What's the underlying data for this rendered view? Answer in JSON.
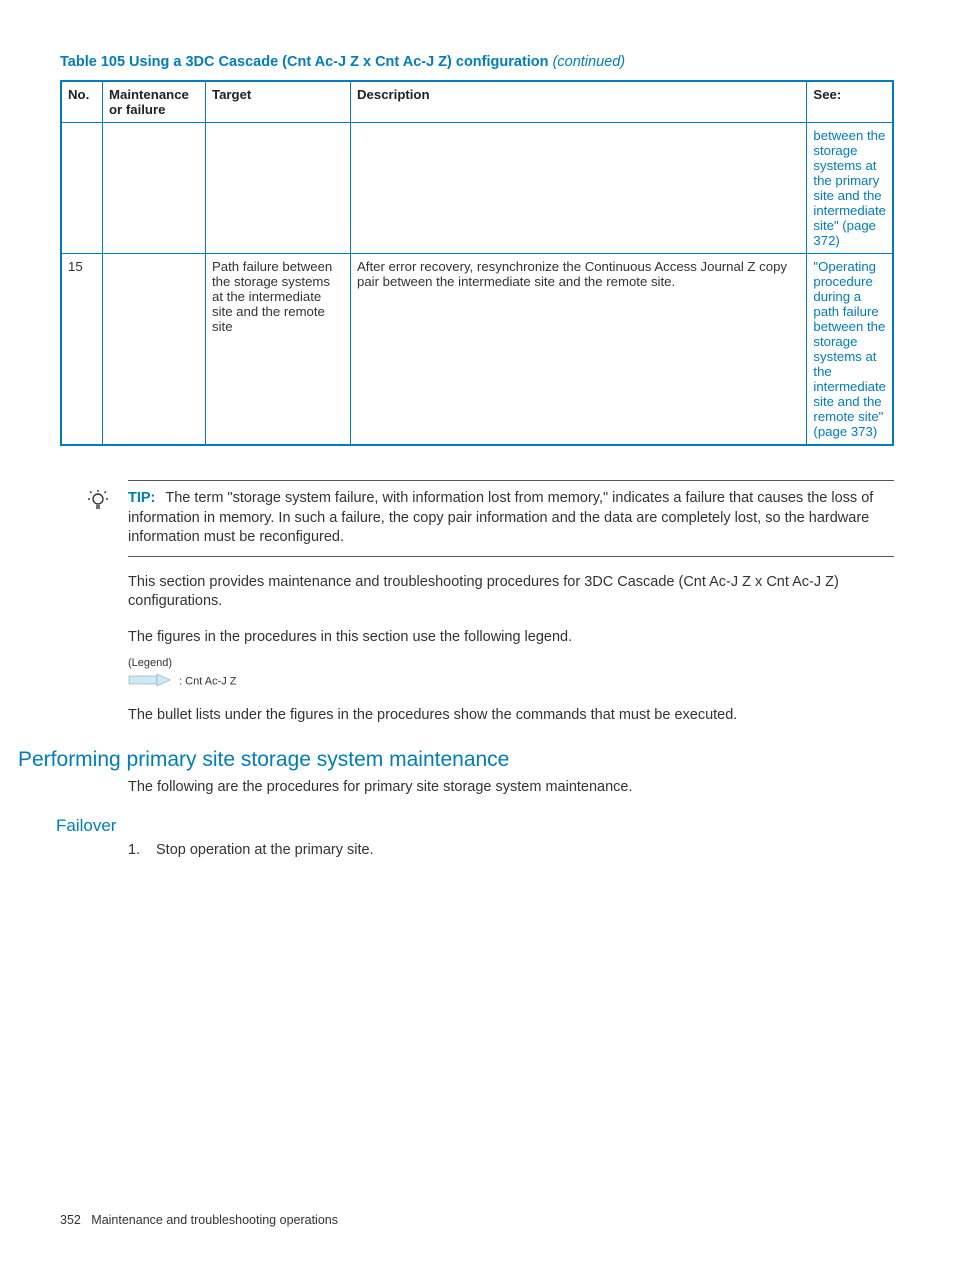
{
  "caption": {
    "prefix": "Table 105 Using a 3DC Cascade (Cnt Ac-J Z x Cnt Ac-J Z) configuration",
    "suffix": "(continued)"
  },
  "headers": {
    "no": "No.",
    "maint": "Maintenance or failure",
    "target": "Target",
    "desc": "Description",
    "see": "See:"
  },
  "row_frag": {
    "see": "between the storage systems at the primary site and the intermediate site\" (page 372)"
  },
  "row15": {
    "no": "15",
    "maint": "",
    "target": "Path failure between the storage systems at the intermediate site and the remote site",
    "desc": "After error recovery, resynchronize the Continuous Access Journal Z copy pair between the intermediate site and the remote site.",
    "see": "\"Operating procedure during a path failure between the storage systems at the intermediate site and the remote site\" (page 373)"
  },
  "tip": {
    "label": "TIP:",
    "text": "The term \"storage system failure, with information lost from memory,\" indicates a failure that causes the loss of information in memory. In such a failure, the copy pair information and the data are completely lost, so the hardware information must be reconfigured."
  },
  "para1": "This section provides maintenance and troubleshooting procedures for 3DC Cascade (Cnt Ac-J Z x Cnt Ac-J Z) configurations.",
  "para2": "The figures in the procedures in this section use the following legend.",
  "legend": {
    "title": "(Legend)",
    "item": ": Cnt Ac-J Z"
  },
  "para3": "The bullet lists under the figures in the procedures show the commands that must be executed.",
  "h2": "Performing primary site storage system maintenance",
  "para4": "The following are the procedures for primary site storage system maintenance.",
  "h3": "Failover",
  "step1": {
    "num": "1.",
    "text": "Stop operation at the primary site."
  },
  "footer": {
    "pagenum": "352",
    "title": "Maintenance and troubleshooting operations"
  }
}
